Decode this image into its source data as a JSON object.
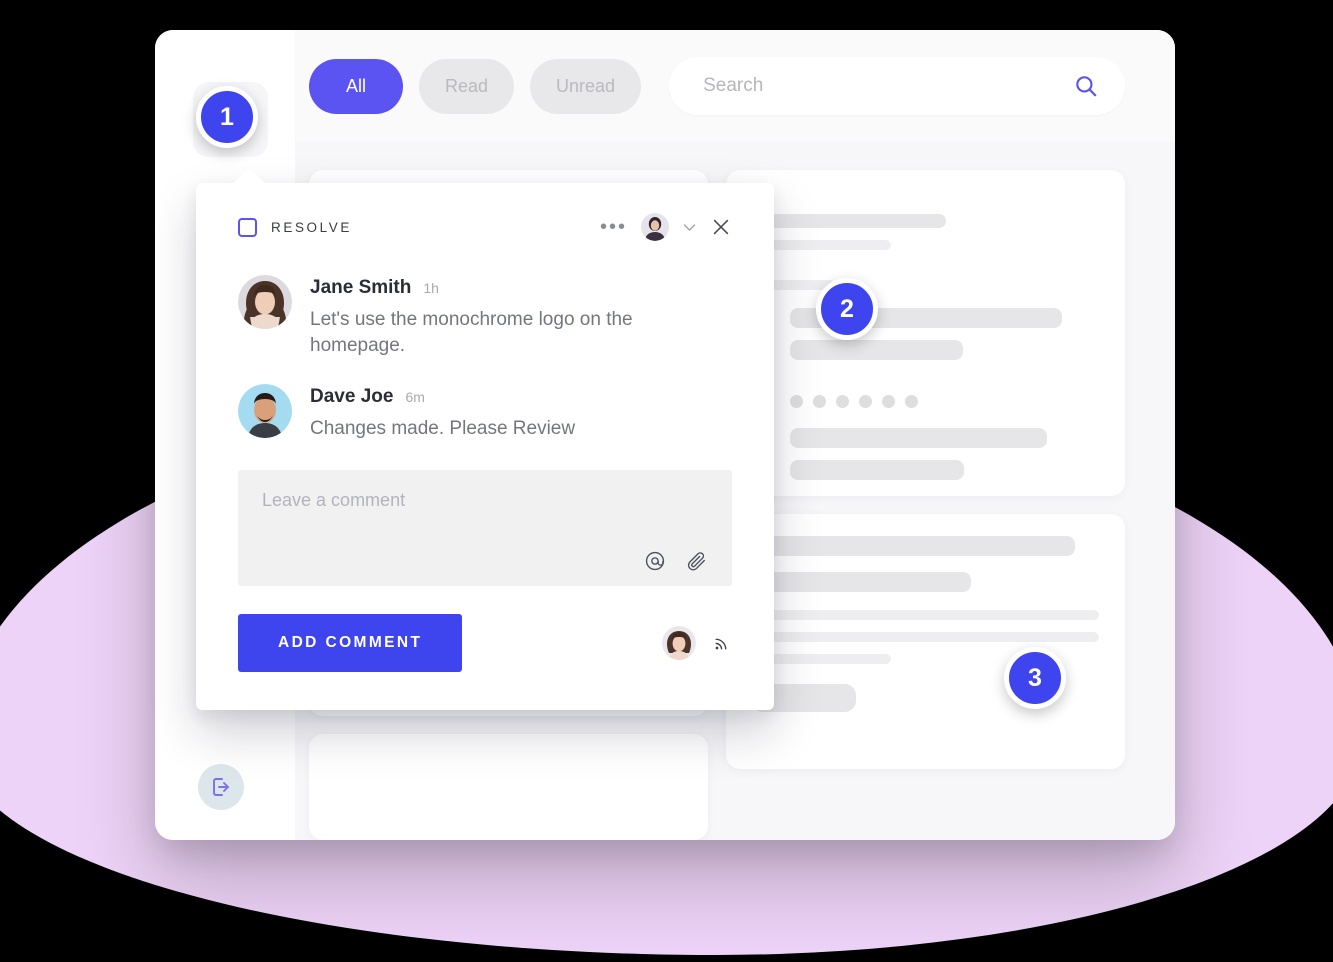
{
  "background": {
    "canvas_color": "#000000",
    "blob_color": "#edd3f7"
  },
  "theme": {
    "accent": "#5b54f2",
    "badge_blue": "#3f45ee",
    "text_dark": "#2c2c38",
    "text_muted": "#757580",
    "skeleton": "#e6e6e8",
    "panel_bg": "#f7f7f9"
  },
  "toolbar": {
    "filters": [
      {
        "label": "All",
        "active": true
      },
      {
        "label": "Read",
        "active": false
      },
      {
        "label": "Unread",
        "active": false
      }
    ],
    "search": {
      "placeholder": "Search",
      "value": "",
      "icon": "search-icon"
    }
  },
  "rail": {
    "logout_icon": "logout-icon"
  },
  "badges": [
    {
      "number": "1"
    },
    {
      "number": "2"
    },
    {
      "number": "3"
    }
  ],
  "popover": {
    "resolve": {
      "label": "RESOLVE",
      "checked": false,
      "checkbox_icon": "checkbox-icon"
    },
    "header_actions": {
      "more_icon": "more-horizontal-icon",
      "avatar_icon": "user-avatar",
      "chevron_icon": "chevron-down-icon",
      "close_icon": "close-icon"
    },
    "comments": [
      {
        "author": "Jane Smith",
        "time": "1h",
        "text": "Let's use the monochrome logo on the homepage.",
        "avatar_icon": "avatar-jane-smith"
      },
      {
        "author": "Dave Joe",
        "time": "6m",
        "text": "Changes made. Please Review",
        "avatar_icon": "avatar-dave-joe"
      }
    ],
    "compose": {
      "placeholder": "Leave a comment",
      "value": "",
      "mention_icon": "at-mention-icon",
      "attach_icon": "paperclip-icon"
    },
    "footer": {
      "submit_label": "ADD COMMENT",
      "avatar_icon": "user-avatar",
      "broadcast_icon": "broadcast-icon"
    }
  },
  "content": {
    "cards": [
      {
        "name": "card-left-top",
        "lines": []
      },
      {
        "name": "card-right-top",
        "icon_rows": [
          {
            "icon": "location-pin-icon"
          },
          {
            "icon": "clock-icon"
          }
        ]
      },
      {
        "name": "card-left-bottom",
        "lines": []
      },
      {
        "name": "card-right-bottom",
        "lines": []
      }
    ]
  }
}
